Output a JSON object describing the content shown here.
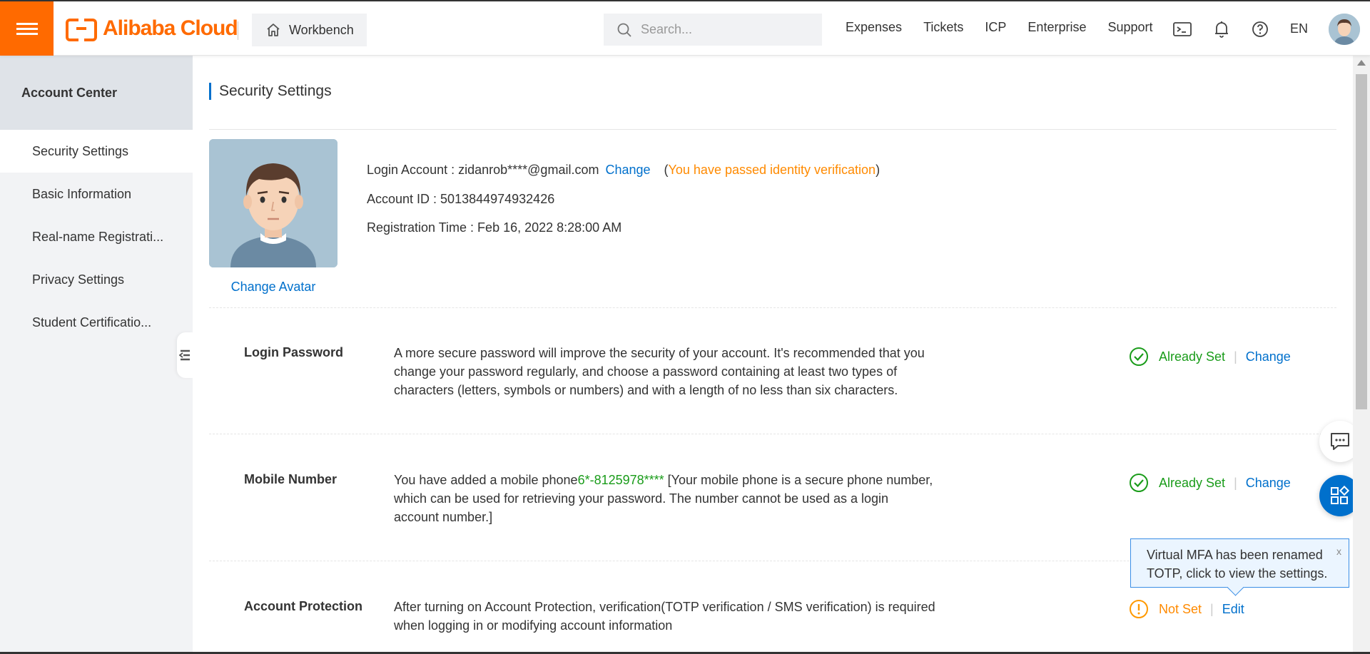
{
  "header": {
    "logo_text": "Alibaba Cloud",
    "workbench_label": "Workbench",
    "search_placeholder": "Search...",
    "nav": [
      "Expenses",
      "Tickets",
      "ICP",
      "Enterprise",
      "Support"
    ],
    "language": "EN",
    "brand_color": "#ff6a00"
  },
  "sidebar": {
    "title": "Account Center",
    "items": [
      {
        "label": "Security Settings",
        "active": true
      },
      {
        "label": "Basic Information"
      },
      {
        "label": "Real-name Registrati..."
      },
      {
        "label": "Privacy Settings"
      },
      {
        "label": "Student Certificatio..."
      }
    ]
  },
  "page": {
    "title": "Security Settings",
    "change_avatar": "Change Avatar",
    "login_account_label": "Login Account : ",
    "login_account_value": "zidanrob****@gmail.com",
    "login_change": "Change",
    "verification_open": "(",
    "verification_text": "You have passed identity verification",
    "verification_close": ")",
    "account_id": "Account ID : 5013844974932426",
    "registration_time": "Registration Time : Feb 16, 2022 8:28:00 AM"
  },
  "rows": {
    "password": {
      "title": "Login Password",
      "desc": "A more secure password will improve the security of your account. It's recommended that you change your password regularly, and choose a password containing at least two types of characters (letters, symbols or numbers) and with a length of no less than six characters.",
      "status": "Already Set",
      "action": "Change"
    },
    "mobile": {
      "title": "Mobile Number",
      "desc_before": "You have added a mobile phone",
      "phone": "6*-8125978****",
      "desc_after": " [Your mobile phone is a secure phone number, which can be used for retrieving your password. The number cannot be used as a login account number.]",
      "status": "Already Set",
      "action": "Change"
    },
    "protection": {
      "title": "Account Protection",
      "desc": "After turning on Account Protection, verification(TOTP verification / SMS verification) is required when logging in or modifying account information",
      "status": "Not Set",
      "action": "Edit"
    }
  },
  "tooltip": {
    "text": "Virtual MFA has been renamed TOTP, click to view the settings.",
    "close": "x"
  }
}
